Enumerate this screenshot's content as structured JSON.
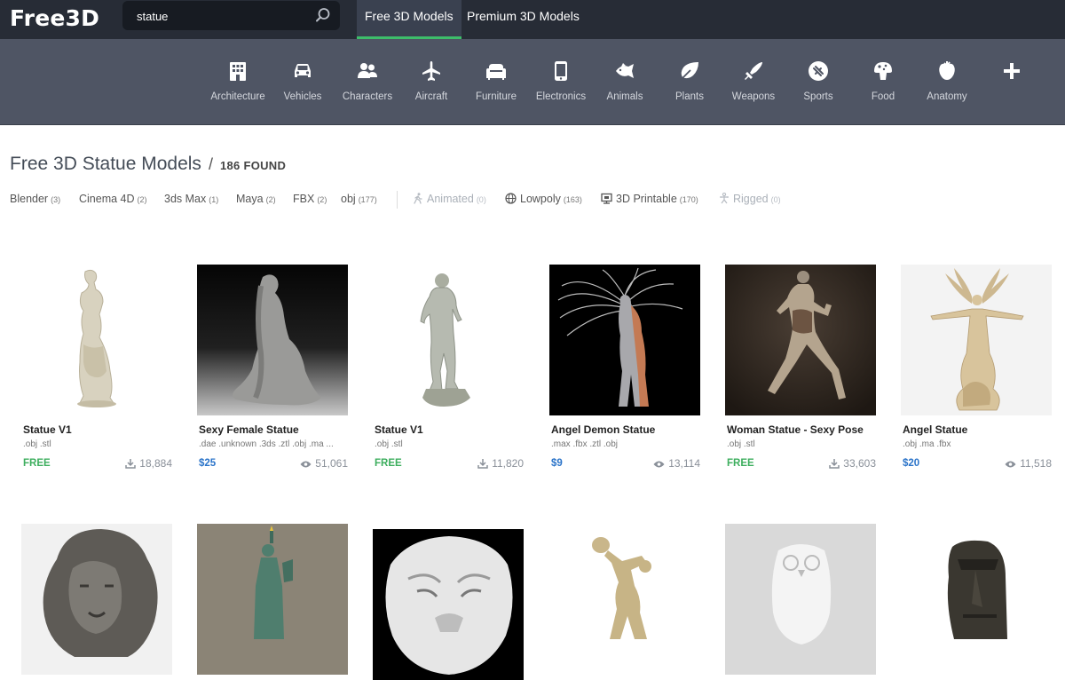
{
  "logo": "Free3D",
  "search": {
    "value": "statue"
  },
  "nav": {
    "free": "Free 3D Models",
    "premium": "Premium 3D Models"
  },
  "categories": [
    {
      "label": "Architecture",
      "icon": "building-icon"
    },
    {
      "label": "Vehicles",
      "icon": "car-icon"
    },
    {
      "label": "Characters",
      "icon": "people-icon"
    },
    {
      "label": "Aircraft",
      "icon": "airplane-icon"
    },
    {
      "label": "Furniture",
      "icon": "sofa-icon"
    },
    {
      "label": "Electronics",
      "icon": "phone-icon"
    },
    {
      "label": "Animals",
      "icon": "fish-icon"
    },
    {
      "label": "Plants",
      "icon": "leaf-icon"
    },
    {
      "label": "Weapons",
      "icon": "sword-icon"
    },
    {
      "label": "Sports",
      "icon": "ball-icon"
    },
    {
      "label": "Food",
      "icon": "mushroom-icon"
    },
    {
      "label": "Anatomy",
      "icon": "anatomy-icon"
    },
    {
      "label": "",
      "icon": "plus-icon"
    }
  ],
  "heading": {
    "title": "Free 3D Statue Models",
    "sep": "/",
    "found": "186 FOUND"
  },
  "filters": {
    "formats": [
      {
        "label": "Blender",
        "count": "(3)"
      },
      {
        "label": "Cinema 4D",
        "count": "(2)"
      },
      {
        "label": "3ds Max",
        "count": "(1)"
      },
      {
        "label": "Maya",
        "count": "(2)"
      },
      {
        "label": "FBX",
        "count": "(2)"
      },
      {
        "label": "obj",
        "count": "(177)"
      }
    ],
    "attributes": [
      {
        "label": "Animated",
        "count": "(0)",
        "icon": "walk-icon"
      },
      {
        "label": "Lowpoly",
        "count": "(163)",
        "icon": "globe-icon"
      },
      {
        "label": "3D Printable",
        "count": "(170)",
        "icon": "printer-icon"
      },
      {
        "label": "Rigged",
        "count": "(0)",
        "icon": "rig-icon"
      }
    ]
  },
  "models": [
    {
      "title": "Statue V1",
      "formats": ".obj .stl",
      "price": "FREE",
      "stat": "18,884",
      "stat_icon": "download-icon",
      "thumb": "venus"
    },
    {
      "title": "Sexy Female Statue",
      "formats": ".dae .unknown .3ds .ztl .obj .ma ...",
      "price": "$25",
      "stat": "51,061",
      "stat_icon": "eye-icon",
      "thumb": "kneeling"
    },
    {
      "title": "Statue V1",
      "formats": ".obj .stl",
      "price": "FREE",
      "stat": "11,820",
      "stat_icon": "download-icon",
      "thumb": "david"
    },
    {
      "title": "Angel Demon Statue",
      "formats": ".max .fbx .ztl .obj",
      "price": "$9",
      "stat": "13,114",
      "stat_icon": "eye-icon",
      "thumb": "angel-demon"
    },
    {
      "title": "Woman Statue - Sexy Pose",
      "formats": ".obj .stl",
      "price": "FREE",
      "stat": "33,603",
      "stat_icon": "download-icon",
      "thumb": "woman-pose"
    },
    {
      "title": "Angel Statue",
      "formats": ".obj .ma .fbx",
      "price": "$20",
      "stat": "11,518",
      "stat_icon": "eye-icon",
      "thumb": "angel"
    },
    {
      "title": "",
      "formats": "",
      "price": "",
      "stat": "",
      "thumb": "lion"
    },
    {
      "title": "",
      "formats": "",
      "price": "",
      "stat": "",
      "thumb": "liberty"
    },
    {
      "title": "",
      "formats": "",
      "price": "",
      "stat": "",
      "thumb": "tiger"
    },
    {
      "title": "",
      "formats": "",
      "price": "",
      "stat": "",
      "thumb": "discobolus"
    },
    {
      "title": "",
      "formats": "",
      "price": "",
      "stat": "",
      "thumb": "owl"
    },
    {
      "title": "",
      "formats": "",
      "price": "",
      "stat": "",
      "thumb": "moai"
    }
  ],
  "colors": {
    "topbar": "#272c36",
    "catbar": "#4f5564",
    "accent_green": "#3dbd6a",
    "free": "#3dae5e",
    "paid": "#2b74c9"
  }
}
